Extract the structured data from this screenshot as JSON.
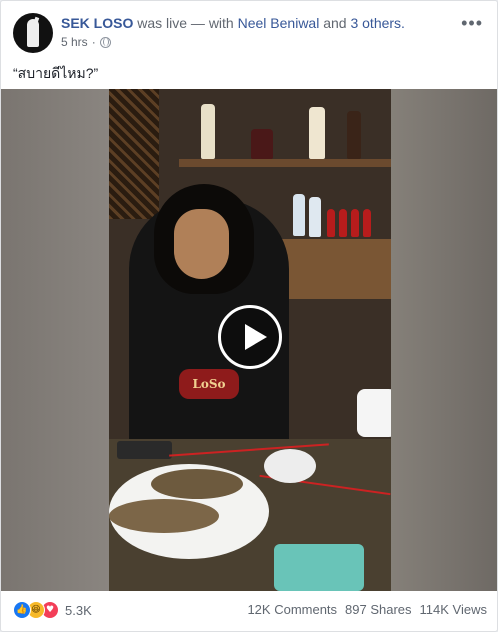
{
  "post": {
    "author": "SEK LOSO",
    "action": "was live — with",
    "tagged": "Neel Beniwal",
    "and": "and",
    "others": "3 others.",
    "time": "5 hrs",
    "dot": "·",
    "text": "“สบายดีไหม?”",
    "more_icon": "•••"
  },
  "video": {
    "shirt_logo": "LoSo",
    "play_icon": "play-icon"
  },
  "footer": {
    "reaction_count": "5.3K",
    "comments": "12K Comments",
    "shares": "897 Shares",
    "views": "114K Views"
  },
  "colors": {
    "link": "#385898",
    "like": "#1877f2",
    "haha": "#f7b928",
    "love": "#f33e58"
  }
}
